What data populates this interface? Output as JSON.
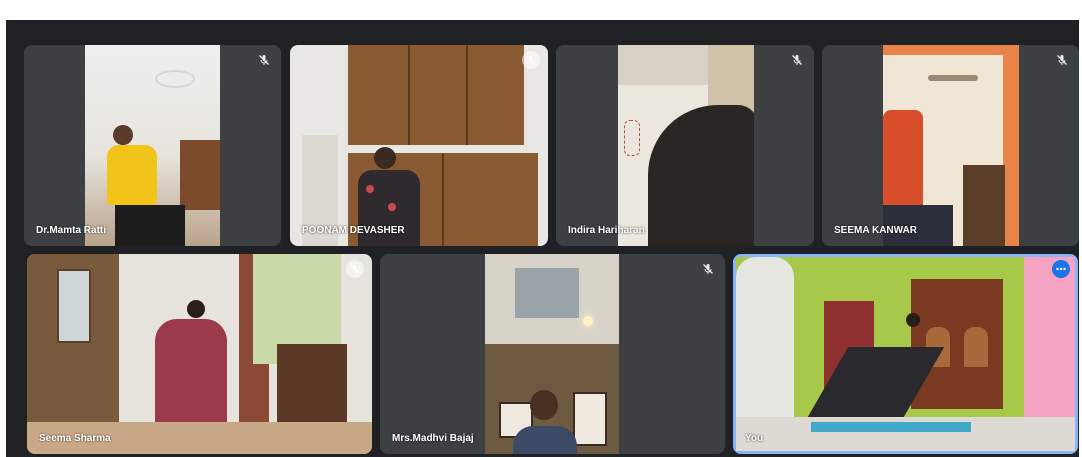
{
  "participants": [
    {
      "name": "Dr.Mamta Ratti",
      "mic": "muted"
    },
    {
      "name": "POONAM DEVASHER",
      "mic": "muted"
    },
    {
      "name": "Indira Hariharan",
      "mic": "muted"
    },
    {
      "name": "SEEMA KANWAR",
      "mic": "muted"
    },
    {
      "name": "Seema Sharma",
      "mic": "muted"
    },
    {
      "name": "Mrs.Madhvi Bajaj",
      "mic": "muted"
    },
    {
      "name": "You",
      "mic": "on"
    }
  ],
  "icons": {
    "mic_off": "mic-off-icon",
    "more": "more-options-icon"
  },
  "colors": {
    "background": "#202124",
    "tile": "#3c4043",
    "accent": "#1a73e8",
    "self_outline": "#8ab4f8"
  }
}
